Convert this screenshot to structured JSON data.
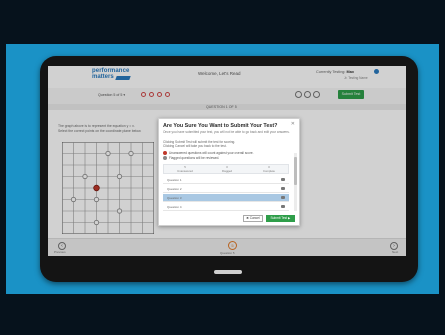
{
  "app": {
    "logo_line1": "performance",
    "logo_line2": "matters",
    "title": "Welcome, Let's Read",
    "user_label": "Currently Testing:",
    "user_name": "Max",
    "user_sub": "Jr. Testing Name"
  },
  "toolbar": {
    "question_nav": "Question 5 of 5 ▾",
    "save_label": "Submit Test"
  },
  "section": {
    "label": "QUESTION 1 OF 5"
  },
  "question": {
    "instruction_1": "The graph above is to represent the equation y = x.",
    "instruction_2": "Select the correct points on the coordinate plane below."
  },
  "grid": {
    "size": 8,
    "points": [
      {
        "x": 4,
        "y": 1
      },
      {
        "x": 6,
        "y": 1
      },
      {
        "x": 2,
        "y": 3
      },
      {
        "x": 5,
        "y": 3
      },
      {
        "x": 1,
        "y": 5
      },
      {
        "x": 3,
        "y": 5
      },
      {
        "x": 5,
        "y": 6
      },
      {
        "x": 3,
        "y": 7
      }
    ],
    "selected_point": {
      "x": 3,
      "y": 4
    }
  },
  "modal": {
    "title": "Are You Sure You Want to Submit Your Test?",
    "intro": "Once you have submitted your test, you will not be able to go back and edit your answers.",
    "instr1": "Clicking Submit Test will submit the test for scoring.",
    "instr2": "Clicking Cancel will take you back to the test.",
    "status1": "Unanswered questions will count against your overall score.",
    "status2": "Flagged questions will be reviewed.",
    "summary": [
      {
        "count": "5",
        "label": "Unanswered"
      },
      {
        "count": "0",
        "label": "Flagged"
      },
      {
        "count": "0",
        "label": "Complete"
      }
    ],
    "rows": [
      {
        "label": "Question 1"
      },
      {
        "label": "Question 2"
      },
      {
        "label": "Question 3"
      },
      {
        "label": "Question 4"
      }
    ],
    "selected_index": 2,
    "cancel_label": "✖ Cancel",
    "submit_label": "Submit Test ▶"
  },
  "bottom": {
    "prev_label": "Previous",
    "page_num": "5",
    "page_label": "Question 5",
    "next_label": "Next"
  },
  "colors": {
    "background_blue": "#1a92c6",
    "accent_blue": "#2a7bbf",
    "submit_green": "#2f9e4a",
    "point_red": "#c0392b"
  }
}
